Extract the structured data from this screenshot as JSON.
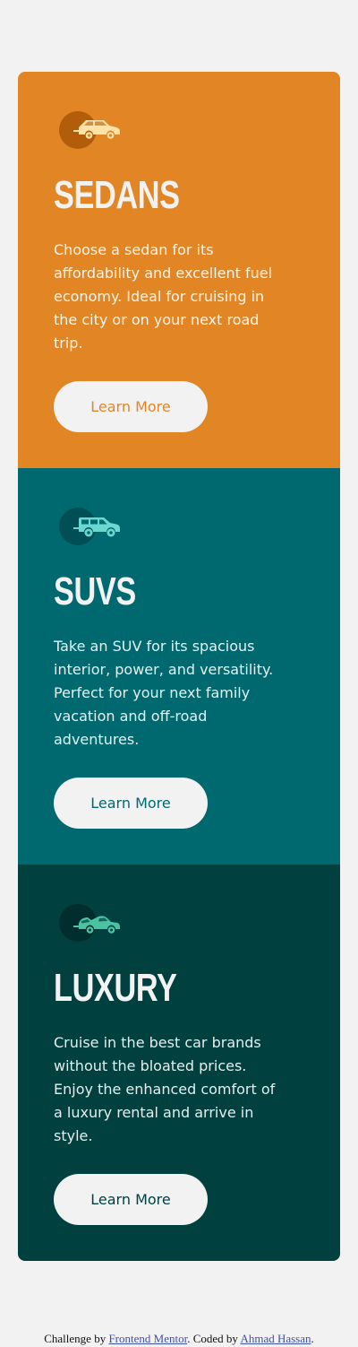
{
  "colors": {
    "sedans": "#e28625",
    "suvs": "#006970",
    "luxury": "#004140",
    "background": "#f2f2f2",
    "link": "#3e52a3"
  },
  "cards": [
    {
      "key": "sedans",
      "icon": "sedan-car-icon",
      "title": "SEDANS",
      "description": "Choose a sedan for its affordability and excellent fuel economy. Ideal for cruising in the city or on your next road trip.",
      "button": "Learn More"
    },
    {
      "key": "suvs",
      "icon": "suv-car-icon",
      "title": "SUVS",
      "description": "Take an SUV for its spacious interior, power, and versatility. Perfect for your next family vacation and off-road adventures.",
      "button": "Learn More"
    },
    {
      "key": "luxury",
      "icon": "luxury-car-icon",
      "title": "LUXURY",
      "description": "Cruise in the best car brands without the bloated prices. Enjoy the enhanced comfort of a luxury rental and arrive in style.",
      "button": "Learn More"
    }
  ],
  "footer": {
    "prefix": "Challenge by ",
    "challenge_link": "Frontend Mentor",
    "middle": ". Coded by ",
    "author_link": "Ahmad Hassan",
    "suffix": "."
  }
}
